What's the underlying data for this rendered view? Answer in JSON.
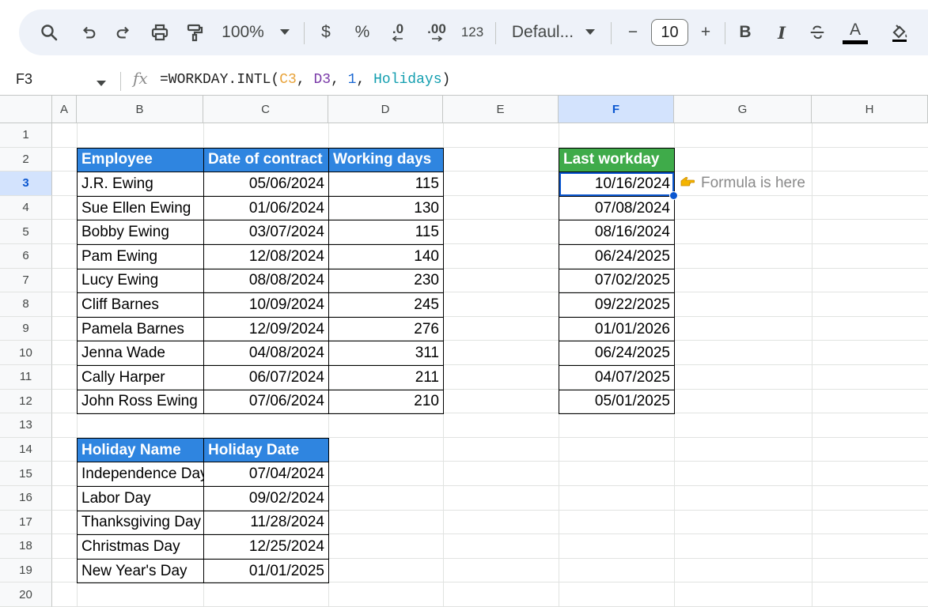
{
  "toolbar": {
    "zoom": "100%",
    "currency": "$",
    "percent": "%",
    "decrease_decimal": ".0",
    "increase_decimal": ".00",
    "number_format": "123",
    "font": "Defaul...",
    "font_size": "10",
    "minus": "−",
    "plus": "+",
    "bold": "B",
    "italic": "I",
    "text_color": "A"
  },
  "formula_bar": {
    "cell_ref": "F3",
    "fx": "fx",
    "parts": [
      "=WORKDAY.INTL(",
      "C3",
      ", ",
      "D3",
      ", ",
      "1",
      ", ",
      "Holidays",
      ")"
    ]
  },
  "columns": [
    "A",
    "B",
    "C",
    "D",
    "E",
    "F",
    "G",
    "H"
  ],
  "selected_column": "F",
  "rows": [
    "1",
    "2",
    "3",
    "4",
    "5",
    "6",
    "7",
    "8",
    "9",
    "10",
    "11",
    "12",
    "13",
    "14",
    "15",
    "16",
    "17",
    "18",
    "19",
    "20"
  ],
  "selected_row": "3",
  "colors": {
    "header_blue": "#2f85e0",
    "header_green": "#3fab4a",
    "selection": "#0b57d0",
    "note_icon": "#f4b400"
  },
  "employees_table": {
    "headers": [
      "Employee",
      "Date of contract",
      "Working days"
    ],
    "rows": [
      [
        "J.R. Ewing",
        "05/06/2024",
        "115"
      ],
      [
        "Sue Ellen Ewing",
        "01/06/2024",
        "130"
      ],
      [
        "Bobby Ewing",
        "03/07/2024",
        "115"
      ],
      [
        "Pam Ewing",
        "12/08/2024",
        "140"
      ],
      [
        "Lucy Ewing",
        "08/08/2024",
        "230"
      ],
      [
        "Cliff Barnes",
        "10/09/2024",
        "245"
      ],
      [
        "Pamela Barnes",
        "12/09/2024",
        "276"
      ],
      [
        "Jenna Wade",
        "04/08/2024",
        "311"
      ],
      [
        "Cally Harper",
        "06/07/2024",
        "211"
      ],
      [
        "John Ross Ewing",
        "07/06/2024",
        "210"
      ]
    ]
  },
  "result_table": {
    "header": "Last workday",
    "values": [
      "10/16/2024",
      "07/08/2024",
      "08/16/2024",
      "06/24/2025",
      "07/02/2025",
      "09/22/2025",
      "01/01/2026",
      "06/24/2025",
      "04/07/2025",
      "05/01/2025"
    ],
    "note": "Formula is here"
  },
  "holidays_table": {
    "headers": [
      "Holiday Name",
      "Holiday Date"
    ],
    "rows": [
      [
        "Independence Day",
        "07/04/2024"
      ],
      [
        "Labor Day",
        "09/02/2024"
      ],
      [
        "Thanksgiving Day",
        "11/28/2024"
      ],
      [
        "Christmas Day",
        "12/25/2024"
      ],
      [
        "New Year's Day",
        "01/01/2025"
      ]
    ]
  }
}
